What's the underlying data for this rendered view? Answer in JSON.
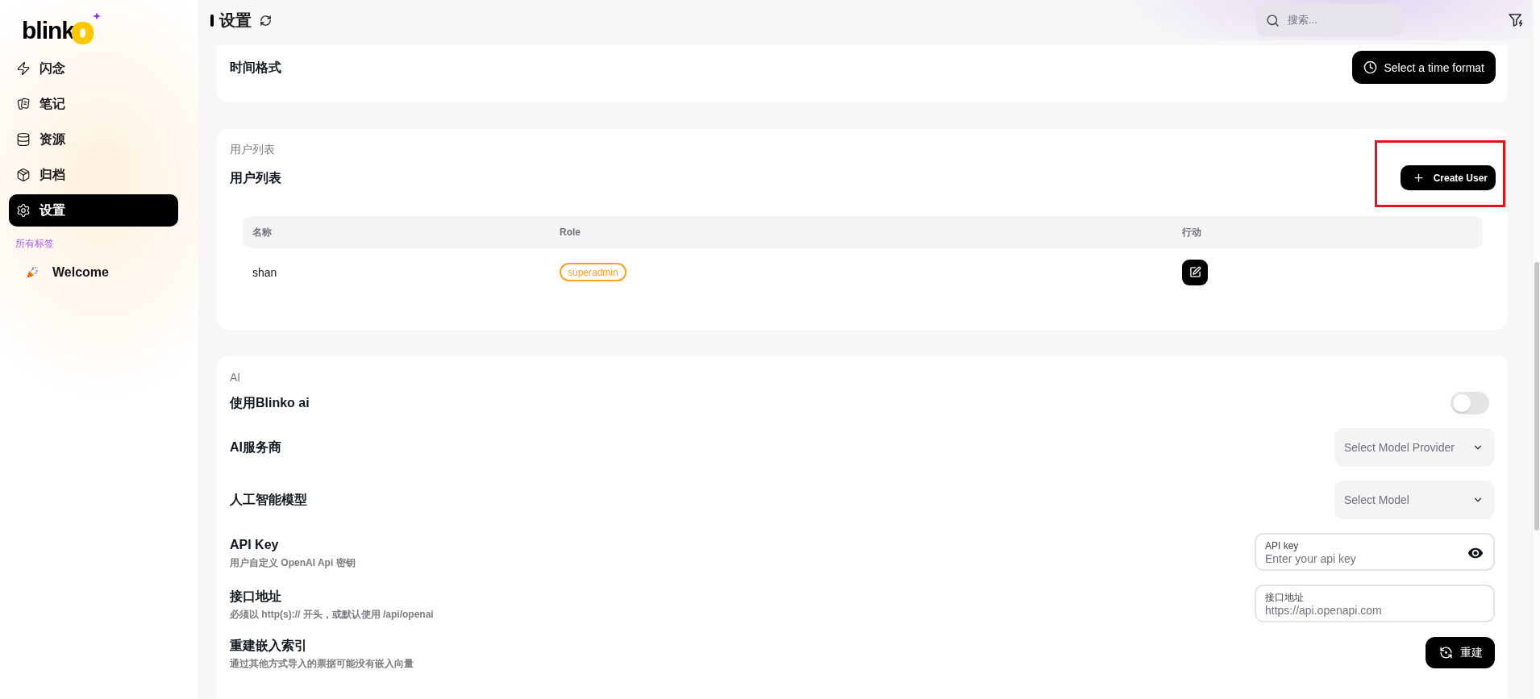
{
  "sidebar": {
    "logo": "blinko",
    "nav": [
      {
        "label": "闪念",
        "selected": false
      },
      {
        "label": "笔记",
        "selected": false
      },
      {
        "label": "资源",
        "selected": false
      },
      {
        "label": "归档",
        "selected": false
      },
      {
        "label": "设置",
        "selected": true
      }
    ],
    "tags_heading": "所有标签",
    "tags": [
      {
        "label": "Welcome"
      }
    ]
  },
  "header": {
    "title": "设置",
    "search": {
      "placeholder": "搜索..."
    }
  },
  "time_format": {
    "label": "时间格式",
    "button": "Select a time format"
  },
  "user_list": {
    "section_title": "用户列表",
    "title": "用户列表",
    "create_button": {
      "label": "Create User",
      "highlighted": true
    },
    "table": {
      "columns": [
        "名称",
        "Role",
        "行动"
      ],
      "rows": [
        {
          "name": "shan",
          "role": "superadmin"
        }
      ]
    }
  },
  "ai": {
    "section_title": "AI",
    "settings": [
      {
        "kind": "switch",
        "label": "使用Blinko ai",
        "on": false
      },
      {
        "kind": "select",
        "label": "AI服务商",
        "placeholder": "Select Model Provider"
      },
      {
        "kind": "select",
        "label": "人工智能模型",
        "placeholder": "Select Model"
      },
      {
        "kind": "input",
        "label": "API Key",
        "description": "用户自定义 OpenAI Api 密钥",
        "field_label": "API key",
        "placeholder": "Enter your api key",
        "secret": true
      },
      {
        "kind": "input",
        "label": "接口地址",
        "description": "必须以 http(s):// 开头，或默认使用 /api/openai",
        "field_label": "接口地址",
        "placeholder": "https://api.openapi.com",
        "secret": false
      },
      {
        "kind": "button",
        "label": "重建嵌入索引",
        "description": "通过其他方式导入的票据可能没有嵌入向量",
        "button": "重建"
      }
    ]
  }
}
